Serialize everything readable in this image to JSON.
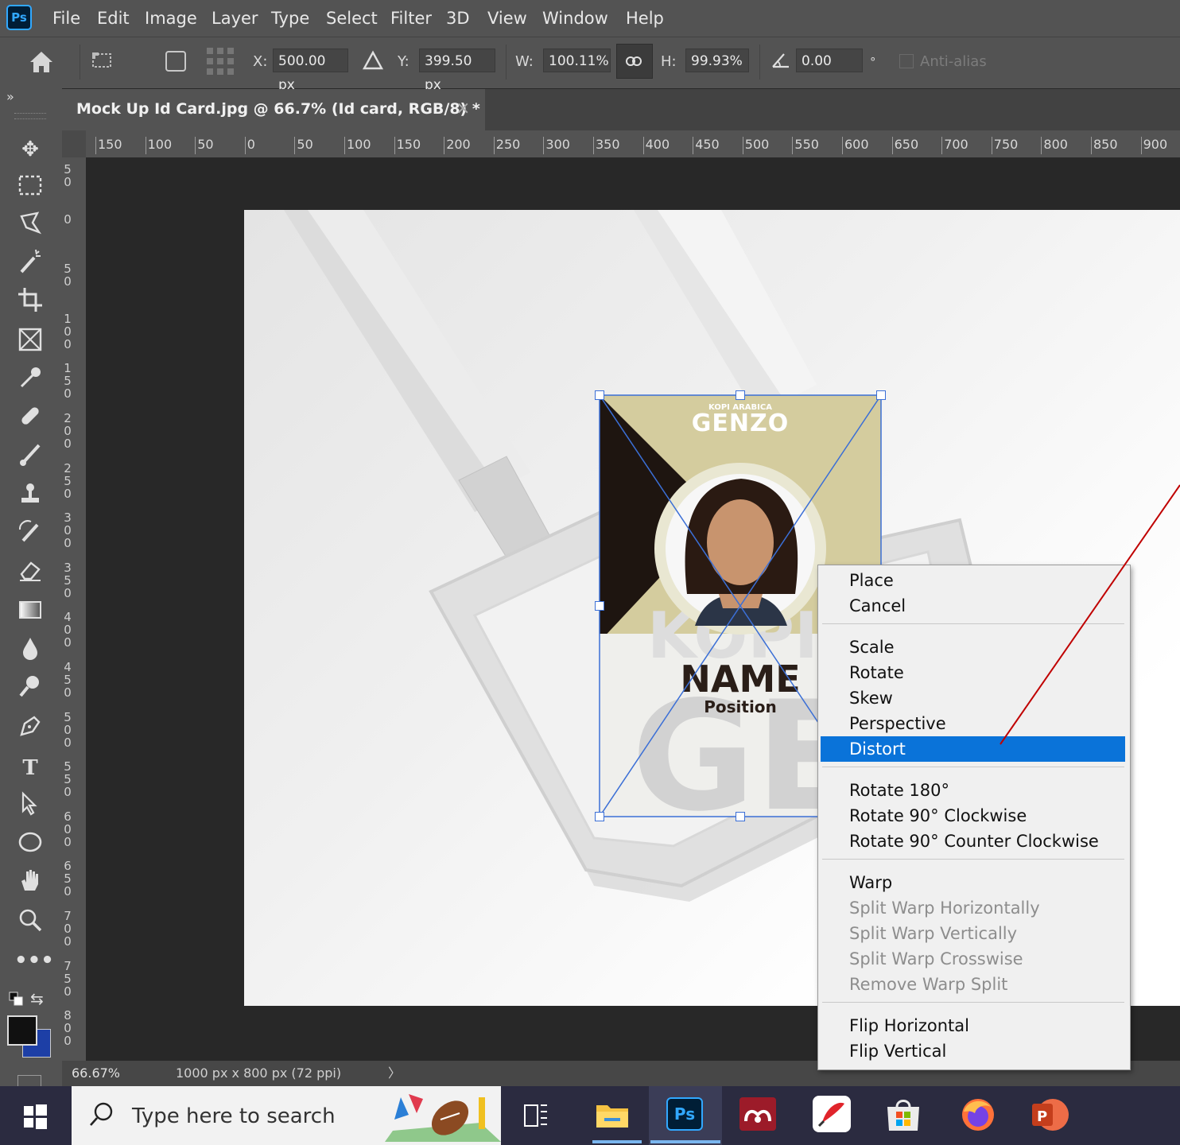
{
  "app": {
    "logo": "Ps"
  },
  "menubar": {
    "items": [
      "File",
      "Edit",
      "Image",
      "Layer",
      "Type",
      "Select",
      "Filter",
      "3D",
      "View",
      "Window",
      "Help"
    ]
  },
  "options": {
    "x_label": "X:",
    "x_value": "500.00 px",
    "y_label": "Y:",
    "y_value": "399.50 px",
    "w_label": "W:",
    "w_value": "100.11%",
    "h_label": "H:",
    "h_value": "99.93%",
    "angle_value": "0.00",
    "degree_symbol": "°",
    "antialias_label": "Anti-alias"
  },
  "document": {
    "tab_title": "Mock Up Id Card.jpg @ 66.7% (Id card, RGB/8) *",
    "close_symbol": "×",
    "collapse_symbol": "»"
  },
  "ruler": {
    "horizontal": [
      "150",
      "100",
      "50",
      "0",
      "50",
      "100",
      "150",
      "200",
      "250",
      "300",
      "350",
      "400",
      "450",
      "500",
      "550",
      "600",
      "650",
      "700",
      "750",
      "800",
      "850",
      "900"
    ],
    "vertical": [
      "50",
      "0",
      "50",
      "100",
      "150",
      "200",
      "250",
      "300",
      "350",
      "400",
      "450",
      "500",
      "550",
      "600",
      "650",
      "700",
      "750",
      "800"
    ]
  },
  "card": {
    "brand_small": "KOPI ARABICA",
    "brand": "GENZO",
    "name": "NAME",
    "position": "Position"
  },
  "context_menu": {
    "groups": [
      [
        "Place",
        "Cancel"
      ],
      [
        "Scale",
        "Rotate",
        "Skew",
        "Perspective",
        "Distort"
      ],
      [
        "Rotate 180°",
        "Rotate 90° Clockwise",
        "Rotate 90° Counter Clockwise"
      ],
      [
        "Warp",
        "Split Warp Horizontally",
        "Split Warp Vertically",
        "Split Warp Crosswise",
        "Remove Warp Split"
      ],
      [
        "Flip Horizontal",
        "Flip Vertical"
      ]
    ],
    "selected": "Distort",
    "disabled": [
      "Split Warp Horizontally",
      "Split Warp Vertically",
      "Split Warp Crosswise",
      "Remove Warp Split"
    ]
  },
  "status": {
    "zoom": "66.67%",
    "doc_info": "1000 px x 800 px (72 ppi)",
    "arrow": "〉"
  },
  "taskbar": {
    "search_placeholder": "Type here to search",
    "apps": [
      "file-explorer",
      "photoshop",
      "mendeley",
      "pen-app",
      "microsoft-store",
      "firefox",
      "powerpoint"
    ]
  },
  "colors": {
    "accent": "#0a73d9",
    "annotation_line": "#c00000",
    "transform_box": "#3b6fd6",
    "card_tan": "#d4cc9e",
    "card_dark": "#1e1510"
  }
}
